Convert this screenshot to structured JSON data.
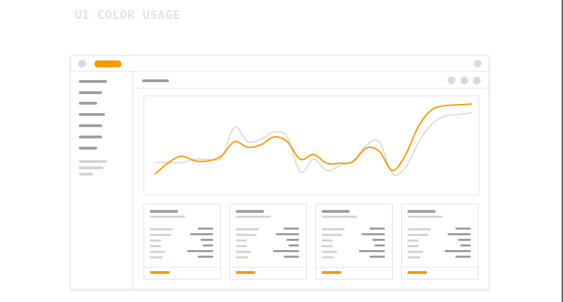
{
  "heading": "UI COLOR USAGE",
  "colors": {
    "accent": "#f59b00",
    "heading": "#e3e3e3",
    "placeholder_dark": "#9e9e9e",
    "placeholder_light": "#d4d4d4",
    "border": "#e6e6e6",
    "dot": "#dadada",
    "comparison_line": "#d9d9d9"
  },
  "window": {
    "titlebar_icons": [
      "traffic-dot-icon",
      "accent-tab-pill",
      "window-dot-icon"
    ],
    "subheader_icons": [
      "action-dot-icon",
      "action-dot-icon",
      "action-dot-icon"
    ]
  },
  "sidebar": {
    "primary_item_count": 7,
    "secondary_item_count": 3
  },
  "cards": [
    {
      "rows": 6
    },
    {
      "rows": 6
    },
    {
      "rows": 6
    },
    {
      "rows": 6
    }
  ],
  "chart_data": {
    "type": "line",
    "title": "",
    "xlabel": "",
    "ylabel": "",
    "x": [
      0,
      2,
      4,
      6,
      8,
      10,
      12,
      14,
      16,
      18,
      20,
      22,
      24,
      26,
      28,
      30,
      32,
      34,
      36,
      38,
      40,
      42,
      44,
      46,
      48
    ],
    "ylim": [
      0,
      100
    ],
    "grid": false,
    "series": [
      {
        "color": "#f59b00",
        "values": [
          12,
          26,
          34,
          28,
          28,
          34,
          52,
          45,
          48,
          58,
          52,
          30,
          36,
          25,
          25,
          27,
          44,
          40,
          16,
          36,
          72,
          92,
          97,
          98,
          99
        ]
      },
      {
        "color": "#d9d9d9",
        "values": [
          26,
          26,
          26,
          30,
          30,
          32,
          70,
          52,
          55,
          64,
          58,
          14,
          30,
          16,
          22,
          28,
          47,
          52,
          12,
          20,
          52,
          74,
          84,
          86,
          88
        ]
      }
    ]
  }
}
